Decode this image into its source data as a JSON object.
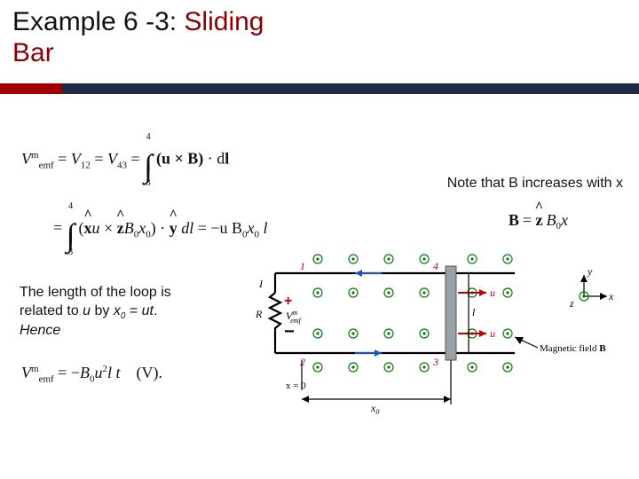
{
  "title": {
    "prefix": "Example 6 -3: ",
    "accent": "Sliding",
    "suffix": "Bar"
  },
  "note": "Note that B increases with x",
  "caption": {
    "line1_a": "The length of the loop is",
    "line1_b": "related to ",
    "u": "u",
    "by": " by ",
    "x0": "x",
    "x0sub": "0",
    "eqseg": " = ",
    "ut": "ut",
    "period": ". ",
    "hence": "Hence"
  },
  "eq1": {
    "lhs_a": "V",
    "lhs_a_sub": "emf",
    "lhs_a_sup": "m",
    "eq": " = ",
    "lhs_b": "V",
    "lhs_b_sub": "12",
    "lhs_c": "V",
    "lhs_c_sub": "43",
    "upper": "4",
    "lower": "3",
    "integrand": "(u × B) · dl"
  },
  "eq2": {
    "upper": "4",
    "lower": "3",
    "body_a": "(",
    "xh": "x",
    "u": "u",
    "times": " × ",
    "zh": "z",
    "B0": "B",
    "B0sub": "0",
    "x0": "x",
    "x0sub": "0",
    "body_b": ") · ",
    "yh": "y",
    "dl": " dl",
    "rhs": " = −u B",
    "rhs_sub": "0",
    "rhs2": "x",
    "rhs2_sub": "0",
    "rhs3": " l"
  },
  "eqB": {
    "B": "B",
    "eq": " = ",
    "zh": "z",
    "B0": "B",
    "B0sub": "0",
    "x": "x"
  },
  "eq3": {
    "lhs": "V",
    "lhs_sub": "emf",
    "lhs_sup": "m",
    "eq": " = −",
    "B0": "B",
    "B0sub": "0",
    "u2": "u",
    "sq": "2",
    "lt": "l t",
    "units": "(V)."
  },
  "diagram": {
    "labels": {
      "R": "R",
      "I": "I",
      "Vemf": "V",
      "Vemf_sub": "emf",
      "Vemf_sup": "m",
      "u": "u",
      "x0": "x",
      "x0sub": "0",
      "xeq0": "x = 0",
      "mag": "Magnetic field ",
      "B": "B",
      "n1": "1",
      "n2": "2",
      "n3": "3",
      "n4": "4",
      "y": "y",
      "x": "x",
      "z": "z",
      "l": "l"
    }
  }
}
